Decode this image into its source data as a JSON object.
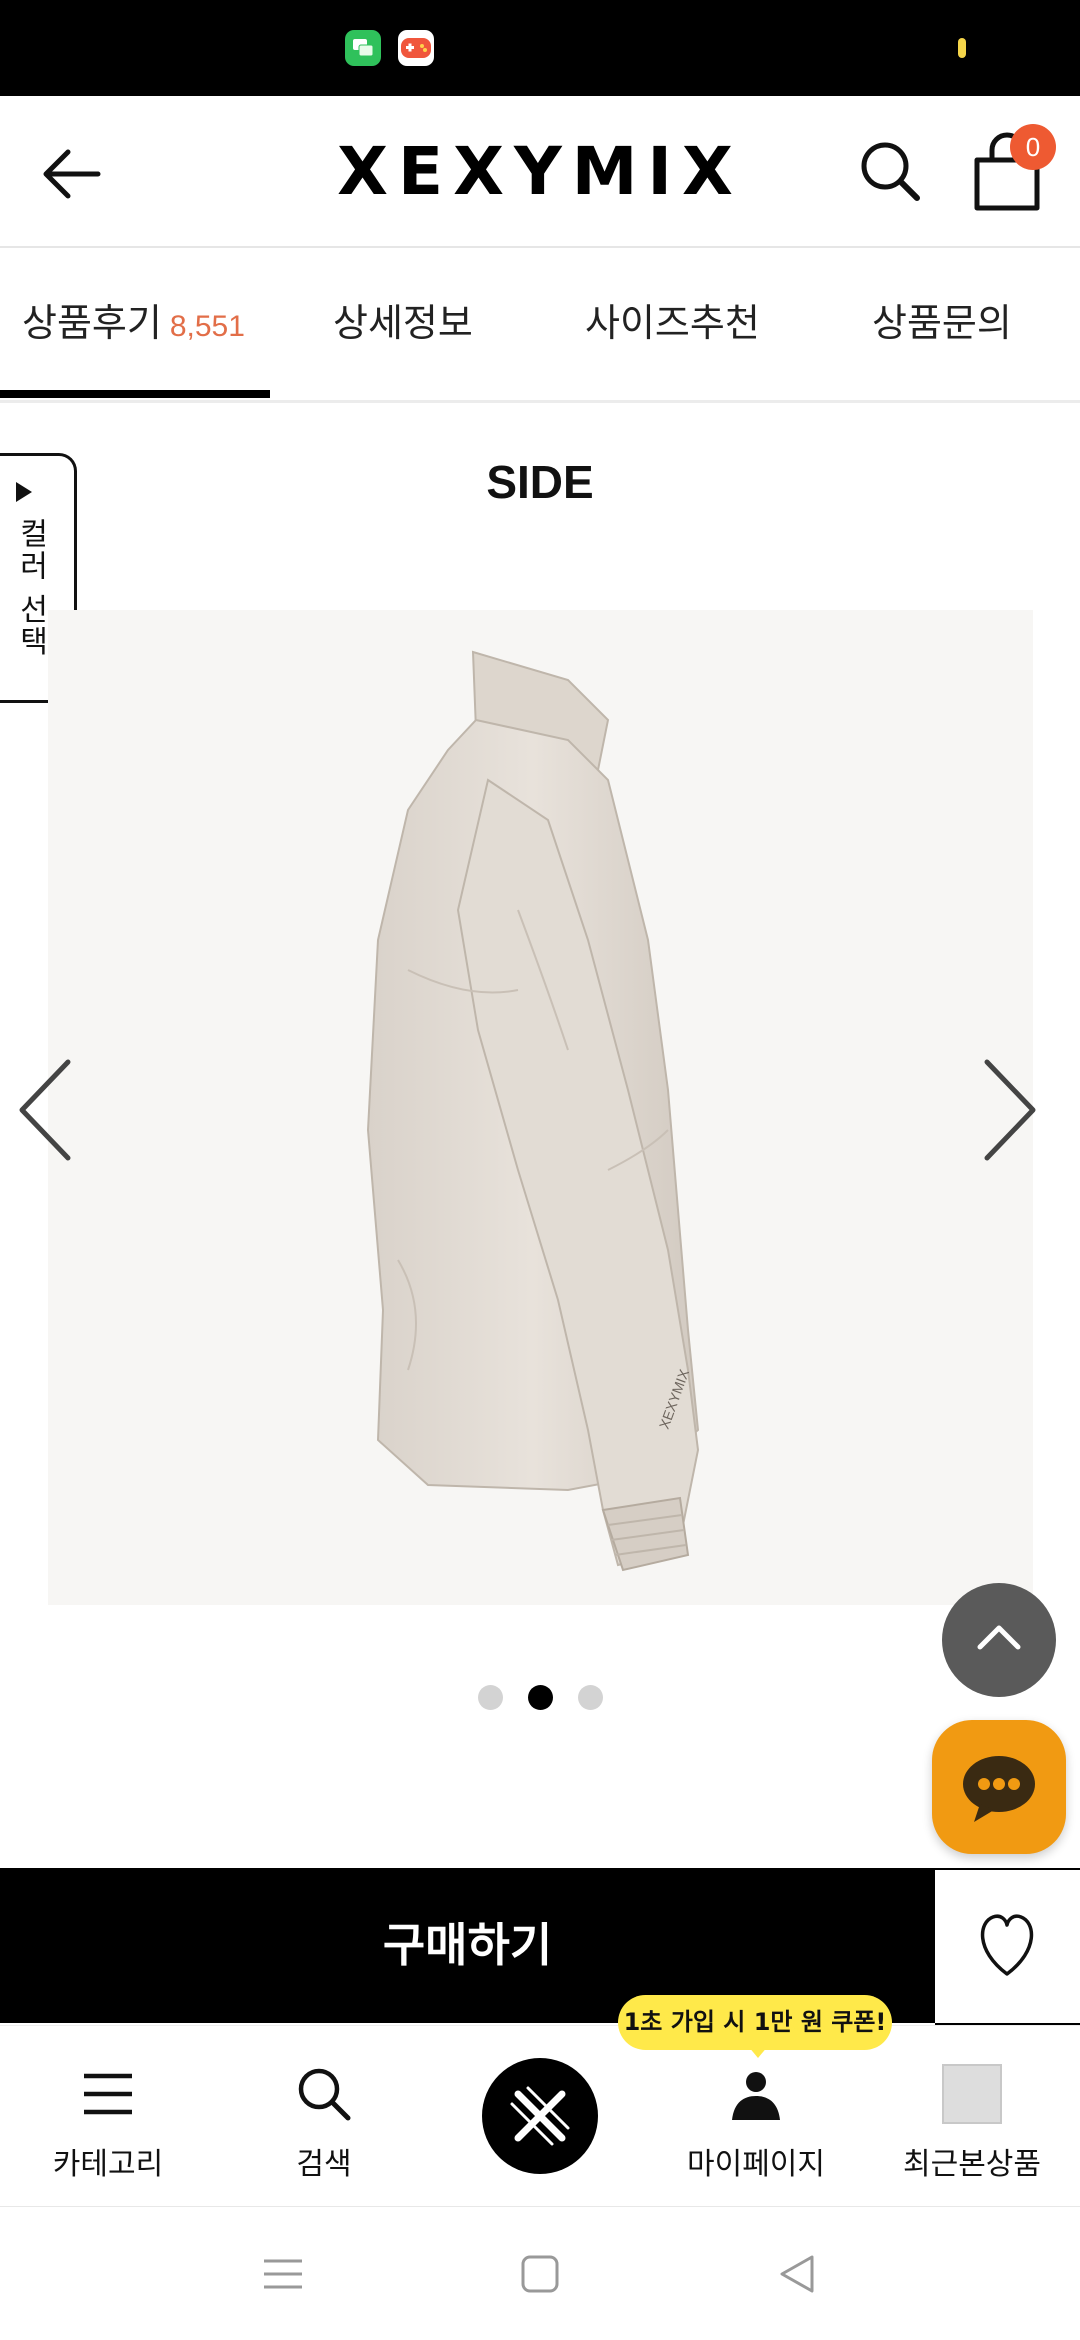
{
  "status_bar": {
    "icons": [
      "messages-app-icon",
      "game-app-icon"
    ],
    "battery_color": "#f5d54a"
  },
  "header": {
    "logo": "XEXYMIX",
    "cart_count": "0",
    "icons": [
      "back-arrow-icon",
      "search-icon",
      "shopping-bag-icon"
    ]
  },
  "tabs": [
    {
      "label": "상품후기",
      "count": "8,551",
      "active": true
    },
    {
      "label": "상세정보",
      "active": false
    },
    {
      "label": "사이즈추천",
      "active": false
    },
    {
      "label": "상품문의",
      "active": false
    }
  ],
  "color_select": {
    "label": "컬러 선택"
  },
  "gallery": {
    "view_label": "SIDE",
    "current_index": 2,
    "total": 3,
    "image": "jacket-side-view"
  },
  "buy": {
    "label": "구매하기"
  },
  "bottom_nav": {
    "items": [
      {
        "label": "카테고리",
        "icon": "menu-icon"
      },
      {
        "label": "검색",
        "icon": "search-icon"
      },
      {
        "label": "",
        "icon": "home-logo-icon"
      },
      {
        "label": "마이페이지",
        "icon": "person-icon"
      },
      {
        "label": "최근본상품",
        "icon": "recent-thumb"
      }
    ],
    "coupon_badge": "1초 가입 시 1만 원 쿠폰!"
  },
  "colors": {
    "accent": "#e26e48",
    "badge": "#ee5a32",
    "chat": "#f19a12",
    "coupon": "#ffe94a"
  }
}
